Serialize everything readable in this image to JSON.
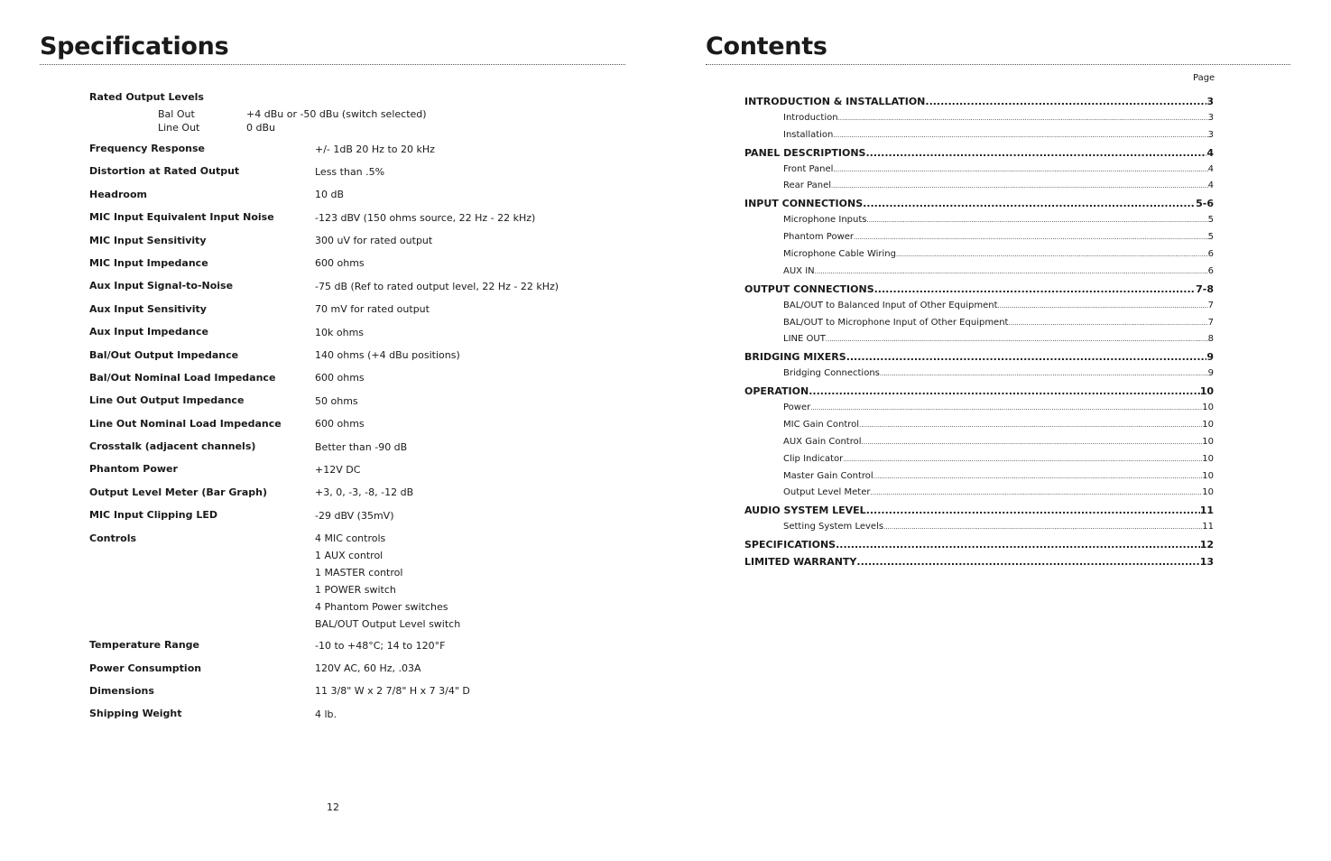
{
  "specifications": {
    "title": "Specifications",
    "page_number": "12",
    "rated_output": {
      "label": "Rated Output Levels",
      "sub": [
        {
          "label": "Bal Out",
          "value": "+4 dBu or -50 dBu (switch selected)"
        },
        {
          "label": "Line Out",
          "value": "0 dBu"
        }
      ]
    },
    "rows": [
      {
        "label": "Frequency Response",
        "values": [
          "+/- 1dB 20 Hz to 20 kHz"
        ]
      },
      {
        "label": "Distortion at Rated Output",
        "values": [
          "Less than .5%"
        ]
      },
      {
        "label": "Headroom",
        "values": [
          "10 dB"
        ]
      },
      {
        "label": "MIC Input Equivalent Input Noise",
        "values": [
          "-123 dBV (150 ohms source, 22 Hz - 22 kHz)"
        ]
      },
      {
        "label": "MIC Input Sensitivity",
        "values": [
          "300 uV for rated output"
        ]
      },
      {
        "label": "MIC Input Impedance",
        "values": [
          "600 ohms"
        ]
      },
      {
        "label": "Aux Input Signal-to-Noise",
        "values": [
          "-75 dB  (Ref to rated output level, 22 Hz - 22 kHz)"
        ]
      },
      {
        "label": "Aux Input Sensitivity",
        "values": [
          "70 mV for rated output"
        ]
      },
      {
        "label": "Aux Input Impedance",
        "values": [
          "10k ohms"
        ]
      },
      {
        "label": "Bal/Out Output Impedance",
        "values": [
          "140 ohms (+4 dBu positions)"
        ]
      },
      {
        "label": "Bal/Out Nominal Load Impedance",
        "values": [
          "600 ohms"
        ]
      },
      {
        "label": "Line Out Output Impedance",
        "values": [
          "50 ohms"
        ]
      },
      {
        "label": "Line Out Nominal Load Impedance",
        "values": [
          "600 ohms"
        ]
      },
      {
        "label": "Crosstalk (adjacent channels)",
        "values": [
          "Better than -90 dB"
        ]
      },
      {
        "label": "Phantom Power",
        "values": [
          "+12V DC"
        ]
      },
      {
        "label": "Output Level Meter (Bar Graph)",
        "values": [
          "+3, 0, -3, -8, -12 dB"
        ]
      },
      {
        "label": "MIC Input Clipping LED",
        "values": [
          "-29 dBV  (35mV)"
        ]
      },
      {
        "label": "Controls",
        "values": [
          "4 MIC controls",
          "1 AUX control",
          "1 MASTER control",
          "1 POWER switch",
          "4 Phantom Power switches",
          "BAL/OUT Output Level switch"
        ]
      },
      {
        "label": "Temperature Range",
        "values": [
          "-10 to +48°C; 14 to 120°F"
        ]
      },
      {
        "label": "Power Consumption",
        "values": [
          "120V AC, 60 Hz, .03A"
        ]
      },
      {
        "label": "Dimensions",
        "values": [
          "11 3/8\" W x 2 7/8\" H x 7 3/4\" D"
        ]
      },
      {
        "label": "Shipping Weight",
        "values": [
          "4 lb."
        ]
      }
    ]
  },
  "contents": {
    "title": "Contents",
    "page_label": "Page",
    "entries": [
      {
        "level": "h",
        "label": "INTRODUCTION & INSTALLATION ",
        "page": "3"
      },
      {
        "level": "s",
        "label": "Introduction ",
        "page": "3"
      },
      {
        "level": "s",
        "label": "Installation",
        "page": "3"
      },
      {
        "level": "h",
        "label": "PANEL DESCRIPTIONS",
        "page": "4"
      },
      {
        "level": "s",
        "label": "Front Panel ",
        "page": "4"
      },
      {
        "level": "s",
        "label": "Rear Panel ",
        "page": "4"
      },
      {
        "level": "h",
        "label": "INPUT CONNECTIONS ",
        "page": "5-6"
      },
      {
        "level": "s",
        "label": "Microphone Inputs ",
        "page": "5"
      },
      {
        "level": "s",
        "label": "Phantom Power",
        "page": "5"
      },
      {
        "level": "s",
        "label": "Microphone Cable Wiring",
        "page": "6"
      },
      {
        "level": "s",
        "label": "AUX IN ",
        "page": "6"
      },
      {
        "level": "h",
        "label": "OUTPUT CONNECTIONS",
        "page": "7-8"
      },
      {
        "level": "s",
        "label": "BAL/OUT to Balanced Input of Other Equipment",
        "page": "7"
      },
      {
        "level": "s",
        "label": "BAL/OUT to Microphone Input of Other Equipment",
        "page": "7"
      },
      {
        "level": "s",
        "label": "LINE OUT",
        "page": "8"
      },
      {
        "level": "h",
        "label": "BRIDGING MIXERS",
        "page": "9"
      },
      {
        "level": "s",
        "label": "Bridging Connections",
        "page": "9"
      },
      {
        "level": "h",
        "label": "OPERATION",
        "page": "10"
      },
      {
        "level": "s",
        "label": "Power ",
        "page": "10"
      },
      {
        "level": "s",
        "label": "MIC Gain Control",
        "page": "10"
      },
      {
        "level": "s",
        "label": "AUX Gain Control",
        "page": "10"
      },
      {
        "level": "s",
        "label": "Clip Indicator",
        "page": "10"
      },
      {
        "level": "s",
        "label": "Master Gain Control ",
        "page": "10"
      },
      {
        "level": "s",
        "label": "Output Level Meter ",
        "page": "10"
      },
      {
        "level": "h",
        "label": "AUDIO SYSTEM LEVEL ",
        "page": "11"
      },
      {
        "level": "s",
        "label": "Setting System Levels",
        "page": "11"
      },
      {
        "level": "h",
        "label": "SPECIFICATIONS ",
        "page": "12"
      },
      {
        "level": "h",
        "label": "LIMITED WARRANTY ",
        "page": "13"
      }
    ]
  }
}
